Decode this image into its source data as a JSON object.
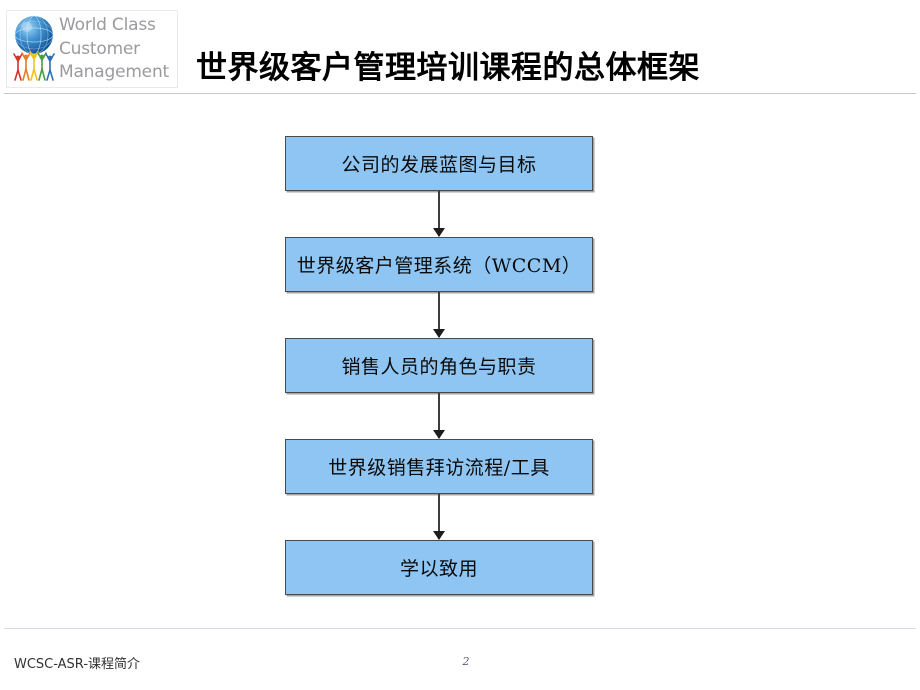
{
  "slide": {
    "title": "世界级客户管理培训课程的总体框架",
    "background_color": "#ffffff"
  },
  "logo": {
    "icon_name": "world-class-customer-management-globe-logo",
    "wordmark_lines": [
      "World Class",
      "Customer",
      "Management"
    ],
    "wordmark_color": "#9b9a9e",
    "globe_color": "#2a7cc7",
    "figure_colors": [
      "#d6322c",
      "#e87d1e",
      "#f0c419",
      "#4c9e3f",
      "#2f6fb5"
    ]
  },
  "chart_data": {
    "type": "diagram",
    "subtype": "vertical-flowchart",
    "title": "世界级客户管理培训课程的总体框架",
    "node_fill": "#8fc5f2",
    "node_border": "#4a4a4a",
    "arrow_color": "#3d3d3d",
    "nodes": [
      {
        "id": "node-1",
        "label": "公司的发展蓝图与目标"
      },
      {
        "id": "node-2",
        "label": "世界级客户管理系统（WCCM）"
      },
      {
        "id": "node-3",
        "label": "销售人员的角色与职责"
      },
      {
        "id": "node-4",
        "label": "世界级销售拜访流程/工具"
      },
      {
        "id": "node-5",
        "label": "学以致用"
      }
    ],
    "edges": [
      {
        "from": "node-1",
        "to": "node-2",
        "style": "single-arrow-down"
      },
      {
        "from": "node-2",
        "to": "node-3",
        "style": "single-arrow-down"
      },
      {
        "from": "node-3",
        "to": "node-4",
        "style": "single-arrow-down"
      },
      {
        "from": "node-4",
        "to": "node-5",
        "style": "single-arrow-down"
      }
    ]
  },
  "footer": {
    "left_text": "WCSC-ASR-课程简介",
    "page_number": "2"
  }
}
